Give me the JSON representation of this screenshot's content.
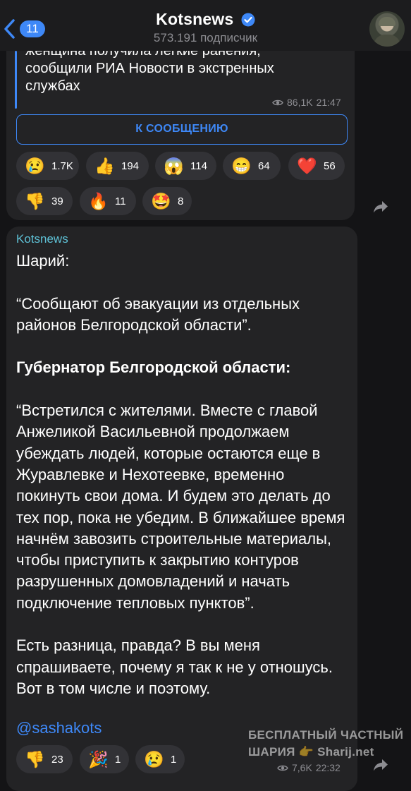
{
  "header": {
    "back_count": "11",
    "title": "Kotsnews",
    "subscribers": "573.191 подписчик"
  },
  "post1": {
    "forward_text": "женщина получила легкие ранения,\nсообщили РИА Новости в экстренных\nслужбах",
    "views": "86,1K",
    "time": "21:47",
    "button_label": "К СООБЩЕНИЮ",
    "reactions": [
      {
        "emoji": "😢",
        "count": "1.7K"
      },
      {
        "emoji": "👍",
        "count": "194"
      },
      {
        "emoji": "😱",
        "count": "114"
      },
      {
        "emoji": "😁",
        "count": "64"
      },
      {
        "emoji": "❤️",
        "count": "56"
      },
      {
        "emoji": "👎",
        "count": "39"
      },
      {
        "emoji": "🔥",
        "count": "11"
      },
      {
        "emoji": "🤩",
        "count": "8"
      }
    ]
  },
  "post2": {
    "sender": "Kotsnews",
    "line1": "Шарий:",
    "quote1": "“Сообщают об эвакуации из отдельных районов Белгородской области”.",
    "heading": "Губернатор Белгородской области:",
    "quote2": "“Встретился с жителями. Вместе с главой Анжеликой Васильевной продолжаем убеждать людей, которые остаются еще в Журавлевке и Нехотеевке, временно покинуть свои дома. И будем это делать до тех пор, пока не убедим. В ближайшее время начнём завозить строительные материалы, чтобы приступить к закрытию контуров разрушенных домовладений и начать подключение тепловых пунктов”.",
    "conclusion": "Есть разница, правда? В вы меня спрашиваете, почему я так к не у отношусь. Вот в том числе и поэтому.",
    "mention": "@sashakots",
    "views": "7,6K",
    "time": "22:32",
    "reactions": [
      {
        "emoji": "👎",
        "count": "23"
      },
      {
        "emoji": "🎉",
        "count": "1"
      },
      {
        "emoji": "😢",
        "count": "1"
      }
    ]
  },
  "watermark": {
    "line1": "БЕСПЛАТНЫЙ ЧАСТНЫЙ",
    "line2": "ШАРИЯ 👉 Sharij.net"
  },
  "colors": {
    "accent": "#3e88f7",
    "bubble": "#232325",
    "background": "#141416",
    "sender": "#5fc3d8"
  }
}
